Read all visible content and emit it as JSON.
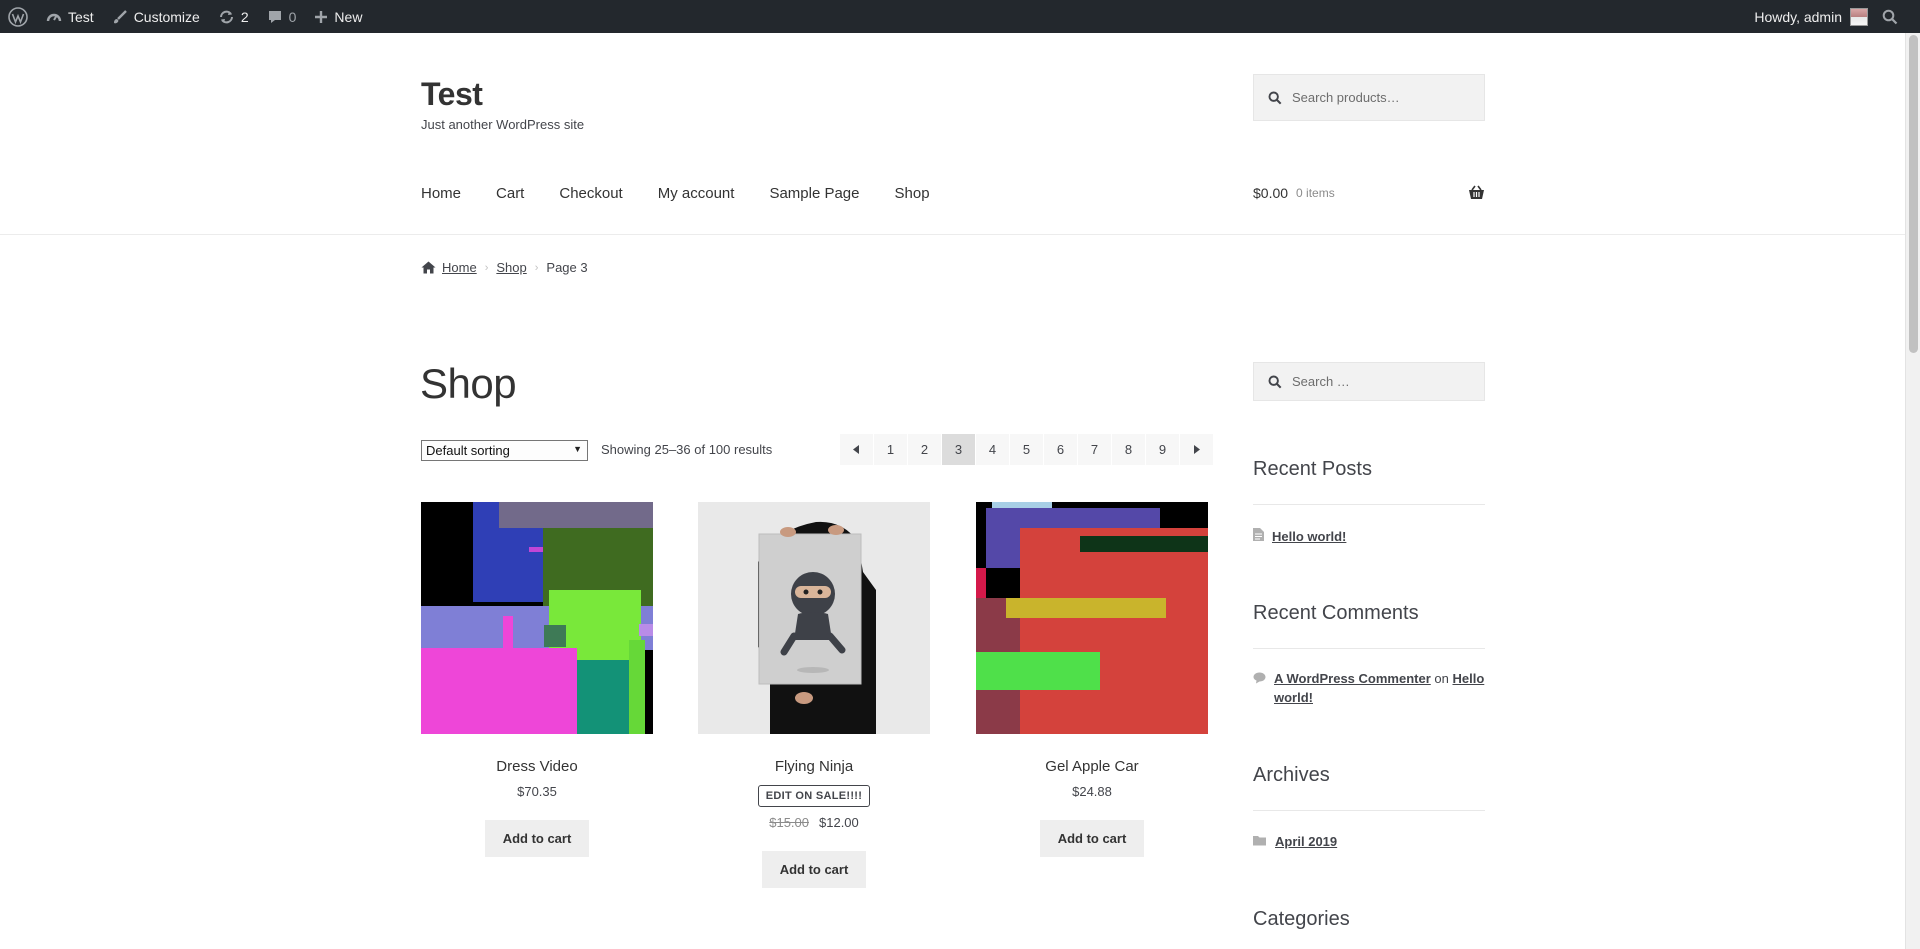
{
  "admin_bar": {
    "site_name": "Test",
    "customize": "Customize",
    "updates": "2",
    "comments": "0",
    "new": "New",
    "howdy": "Howdy, admin"
  },
  "header": {
    "site_title": "Test",
    "tagline": "Just another WordPress site",
    "search_placeholder": "Search products…",
    "nav": [
      "Home",
      "Cart",
      "Checkout",
      "My account",
      "Sample Page",
      "Shop"
    ],
    "cart_amount": "$0.00",
    "cart_count": "0 items"
  },
  "breadcrumb": {
    "home": "Home",
    "shop": "Shop",
    "current": "Page 3"
  },
  "main": {
    "title": "Shop",
    "sorting": "Default sorting",
    "result_count": "Showing 25–36 of 100 results",
    "pagination": {
      "pages": [
        "1",
        "2",
        "3",
        "4",
        "5",
        "6",
        "7",
        "8",
        "9"
      ],
      "current": "3"
    },
    "products": [
      {
        "title": "Dress Video",
        "price": "$70.35",
        "button": "Add to cart"
      },
      {
        "title": "Flying Ninja",
        "badge": "EDIT ON SALE!!!!",
        "old_price": "$15.00",
        "price": "$12.00",
        "button": "Add to cart"
      },
      {
        "title": "Gel Apple Car",
        "price": "$24.88",
        "button": "Add to cart"
      }
    ]
  },
  "sidebar": {
    "search_placeholder": "Search …",
    "recent_posts_title": "Recent Posts",
    "recent_posts": [
      "Hello world!"
    ],
    "recent_comments_title": "Recent Comments",
    "comment_author": "A WordPress Commenter",
    "comment_on": "on",
    "comment_post": "Hello world!",
    "archives_title": "Archives",
    "archives": [
      "April 2019"
    ],
    "categories_title": "Categories"
  },
  "colors": {
    "admin_bar_bg": "#23282d",
    "text": "#43454b",
    "button_bg": "#eeeeee"
  }
}
